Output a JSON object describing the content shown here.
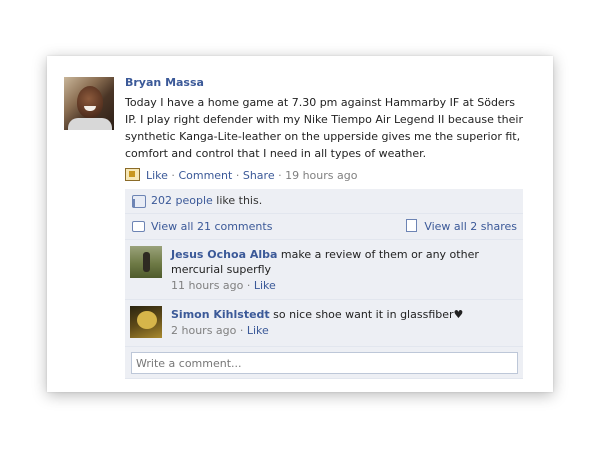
{
  "post": {
    "author": "Bryan Massa",
    "text": "Today I have a home game at 7.30 pm against Hammarby IF at Söders IP. I play right defender with my Nike Tiempo Air Legend II  because their synthetic Kanga-Lite-leather on the upperside gives me the superior fit, comfort and control that I need in all types of weather.",
    "actions": {
      "like": "Like",
      "comment": "Comment",
      "share": "Share",
      "time": "19 hours ago",
      "separator": " · "
    }
  },
  "likes": {
    "count_link": "202 people",
    "suffix": " like this."
  },
  "view_all": {
    "comments": "View all 21 comments",
    "shares": "View all 2 shares"
  },
  "comments": [
    {
      "name": "Jesus Ochoa Alba",
      "text": "make a review of them or any other mercurial superfly",
      "time": "11 hours ago",
      "like": "Like"
    },
    {
      "name": "Simon Kihlstedt",
      "text": "so nice shoe want it in glassfiber♥",
      "time": "2 hours ago",
      "like": "Like"
    }
  ],
  "compose": {
    "placeholder": "Write a comment..."
  },
  "colors": {
    "link": "#3b5998",
    "ufi_bg": "#edeff4",
    "meta": "#808080"
  }
}
